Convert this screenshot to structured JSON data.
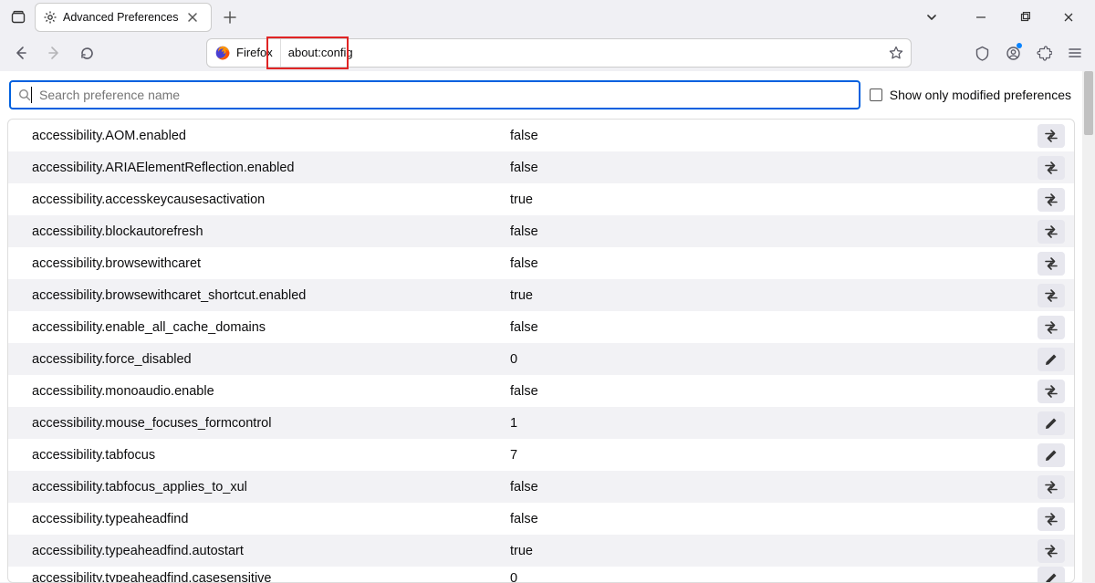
{
  "window": {
    "tab_title": "Advanced Preferences"
  },
  "toolbar": {
    "identity_label": "Firefox",
    "url": "about:config"
  },
  "search": {
    "placeholder": "Search preference name",
    "show_modified_label": "Show only modified preferences",
    "show_modified_checked": false
  },
  "prefs": [
    {
      "name": "accessibility.AOM.enabled",
      "value": "false",
      "type": "bool"
    },
    {
      "name": "accessibility.ARIAElementReflection.enabled",
      "value": "false",
      "type": "bool"
    },
    {
      "name": "accessibility.accesskeycausesactivation",
      "value": "true",
      "type": "bool"
    },
    {
      "name": "accessibility.blockautorefresh",
      "value": "false",
      "type": "bool"
    },
    {
      "name": "accessibility.browsewithcaret",
      "value": "false",
      "type": "bool"
    },
    {
      "name": "accessibility.browsewithcaret_shortcut.enabled",
      "value": "true",
      "type": "bool"
    },
    {
      "name": "accessibility.enable_all_cache_domains",
      "value": "false",
      "type": "bool"
    },
    {
      "name": "accessibility.force_disabled",
      "value": "0",
      "type": "int"
    },
    {
      "name": "accessibility.monoaudio.enable",
      "value": "false",
      "type": "bool"
    },
    {
      "name": "accessibility.mouse_focuses_formcontrol",
      "value": "1",
      "type": "int"
    },
    {
      "name": "accessibility.tabfocus",
      "value": "7",
      "type": "int"
    },
    {
      "name": "accessibility.tabfocus_applies_to_xul",
      "value": "false",
      "type": "bool"
    },
    {
      "name": "accessibility.typeaheadfind",
      "value": "false",
      "type": "bool"
    },
    {
      "name": "accessibility.typeaheadfind.autostart",
      "value": "true",
      "type": "bool"
    },
    {
      "name": "accessibility.typeaheadfind.casesensitive",
      "value": "0",
      "type": "int"
    }
  ]
}
